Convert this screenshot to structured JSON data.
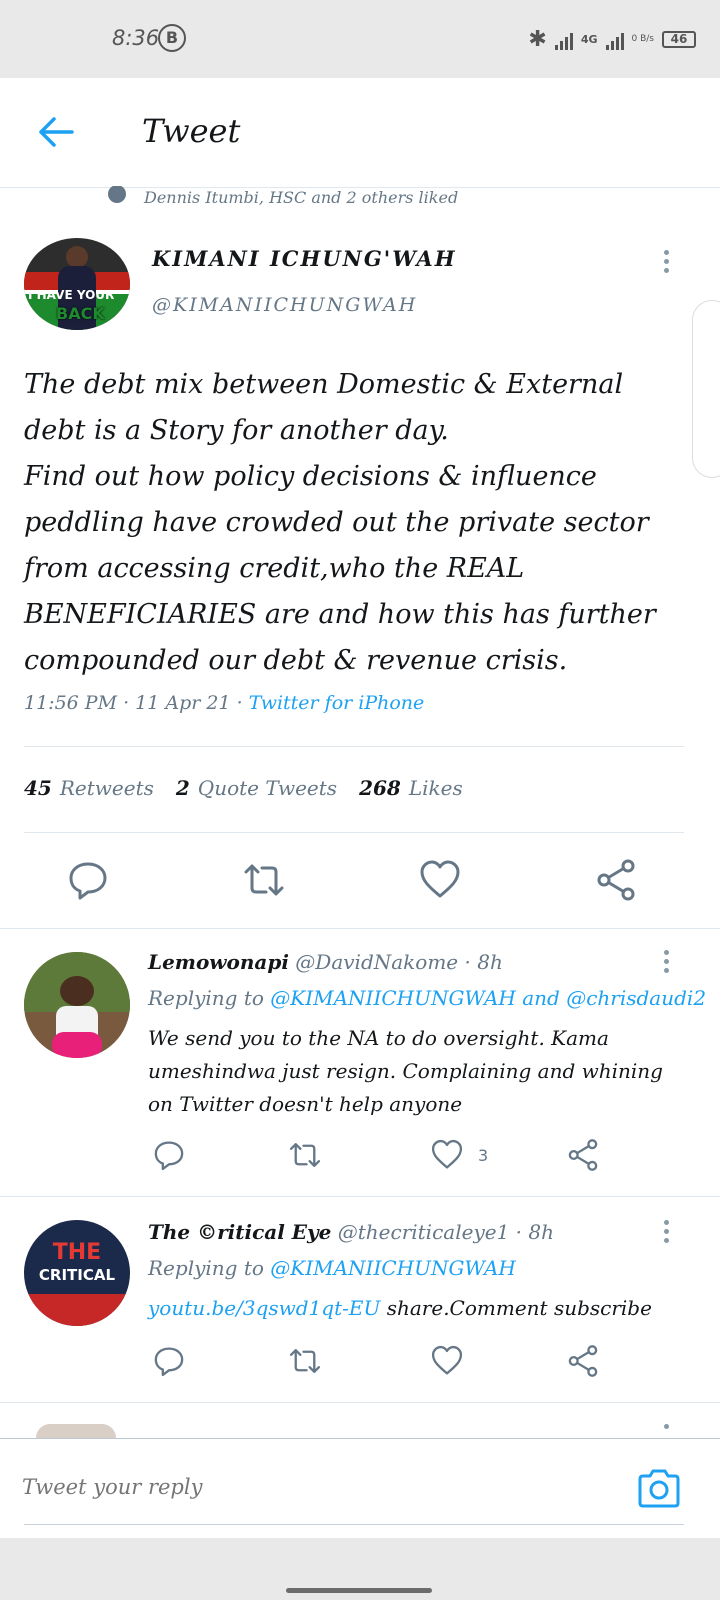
{
  "status_bar": {
    "time": "8:36",
    "badge": "B",
    "network": "4G",
    "speed": "0 B/s",
    "battery": "46"
  },
  "header": {
    "title": "Tweet"
  },
  "social_context": "Dennis Itumbi, HSC and 2 others liked",
  "tweet": {
    "author_name": "KIMANI ICHUNG'WAH",
    "author_handle": "@KIMANIICHUNGWAH",
    "avatar_text_top": "I HAVE YOUR",
    "avatar_text_bottom": "BACK",
    "text": "The debt mix between Domestic & External debt is a Story for another day.\nFind out how policy decisions & influence peddling have crowded out the private sector from accessing credit,who the REAL BENEFICIARIES are and how this has further compounded our debt & revenue crisis.",
    "time": "11:56 PM",
    "date": "11 Apr 21",
    "source": "Twitter for iPhone",
    "retweets": "45",
    "retweets_label": "Retweets",
    "quotes": "2",
    "quotes_label": "Quote Tweets",
    "likes": "268",
    "likes_label": "Likes"
  },
  "replies": [
    {
      "name": "Lemowonapi",
      "handle": "@DavidNakome",
      "age": "8h",
      "replying_label": "Replying to",
      "replying_to": "@KIMANIICHUNGWAH",
      "replying_and": "and",
      "replying_to_2": "@chrisdaudi2",
      "text": "We send you to the NA to do oversight. Kama umeshindwa just resign. Complaining and whining on Twitter doesn't help anyone",
      "likes": "3"
    },
    {
      "name": "The ©ritical Eye",
      "handle": "@thecriticaleye1",
      "age": "8h",
      "replying_label": "Replying to",
      "replying_to": "@KIMANIICHUNGWAH",
      "link": "youtu.be/3qswd1qt-EU",
      "text_after": " share.Comment subscribe",
      "avatar_text_1": "THE",
      "avatar_text_2": "CRITICAL"
    }
  ],
  "compose": {
    "placeholder": "Tweet your reply"
  },
  "colors": {
    "accent": "#1da1f2",
    "muted": "#657786",
    "text": "#14171a"
  }
}
